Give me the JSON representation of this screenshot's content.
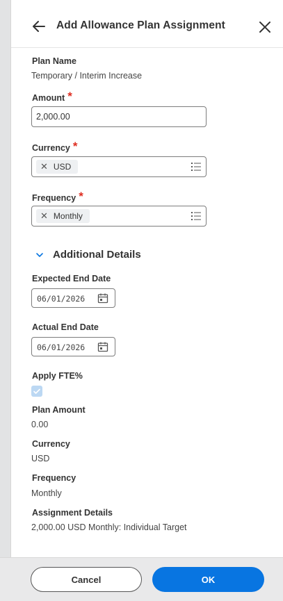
{
  "header": {
    "title": "Add Allowance Plan Assignment"
  },
  "form": {
    "plan_name_label": "Plan Name",
    "plan_name_value": "Temporary / Interim Increase",
    "amount_label": "Amount",
    "amount_value": "2,000.00",
    "required_mark": "*",
    "currency_label": "Currency",
    "currency_value": "USD",
    "frequency_label": "Frequency",
    "frequency_value": "Monthly"
  },
  "additional": {
    "section_title": "Additional Details",
    "expected_end_label": "Expected End Date",
    "expected_end_value": "06/01/2026",
    "actual_end_label": "Actual End Date",
    "actual_end_value": "06/01/2026",
    "apply_fte_label": "Apply FTE%",
    "apply_fte_checked": true,
    "plan_amount_label": "Plan Amount",
    "plan_amount_value": "0.00",
    "currency_label": "Currency",
    "currency_value": "USD",
    "frequency_label": "Frequency",
    "frequency_value": "Monthly",
    "assignment_details_label": "Assignment Details",
    "assignment_details_value": "2,000.00 USD Monthly: Individual Target"
  },
  "footer": {
    "cancel_label": "Cancel",
    "ok_label": "OK"
  },
  "icons": {
    "back": "arrow-left-icon",
    "close": "close-icon",
    "remove": "x-icon",
    "list": "list-icon",
    "chevron": "chevron-down-icon",
    "calendar": "calendar-icon",
    "check": "check-icon"
  },
  "colors": {
    "primary": "#0875e1",
    "required": "#de2e21",
    "checkbox": "#bcd8f3"
  }
}
